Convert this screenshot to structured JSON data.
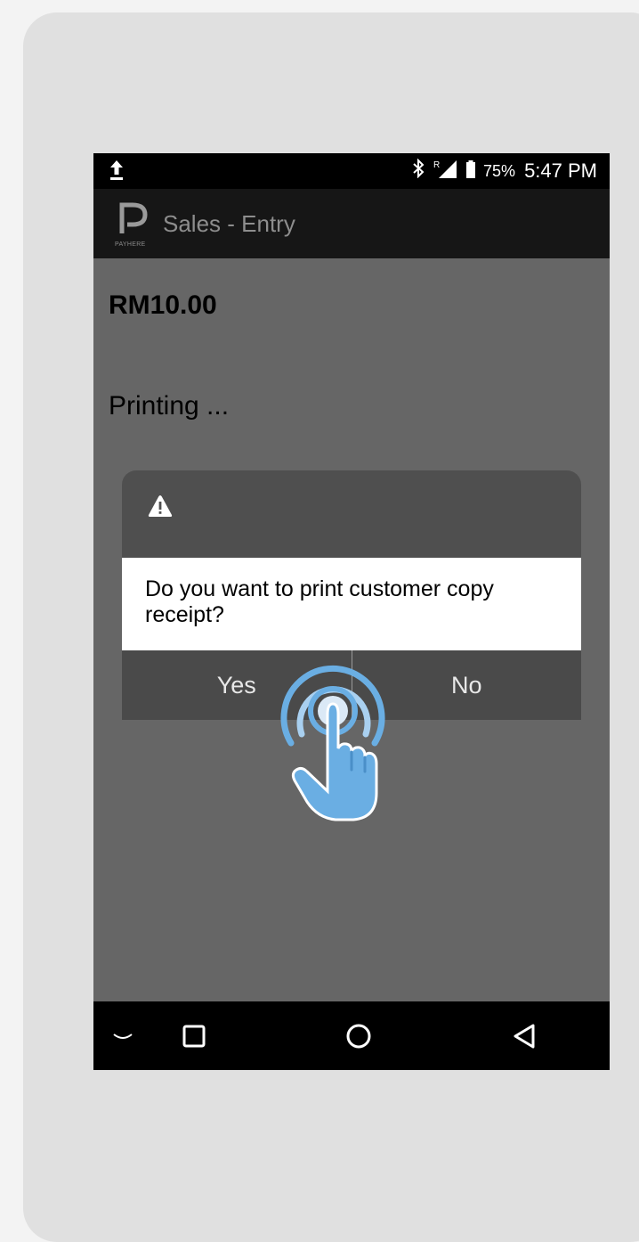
{
  "statusbar": {
    "battery_percent": "75%",
    "time": "5:47 PM",
    "signal_label": "R",
    "icons": [
      "upload-icon",
      "bluetooth-icon",
      "signal-icon",
      "battery-icon"
    ]
  },
  "appbar": {
    "logo_text": "PAYHERE",
    "title": "Sales - Entry"
  },
  "content": {
    "amount": "RM10.00",
    "status": "Printing ..."
  },
  "dialog": {
    "icon": "warning-icon",
    "message": "Do you want to print customer copy receipt?",
    "yes_label": "Yes",
    "no_label": "No"
  },
  "navbar": {
    "icons": [
      "keyboard-hide-icon",
      "recent-apps-icon",
      "home-icon",
      "back-icon"
    ]
  },
  "colors": {
    "tap_highlight": "#6aaee3",
    "screen_bg": "#666666",
    "dialog_bg": "#4f4f4f"
  }
}
